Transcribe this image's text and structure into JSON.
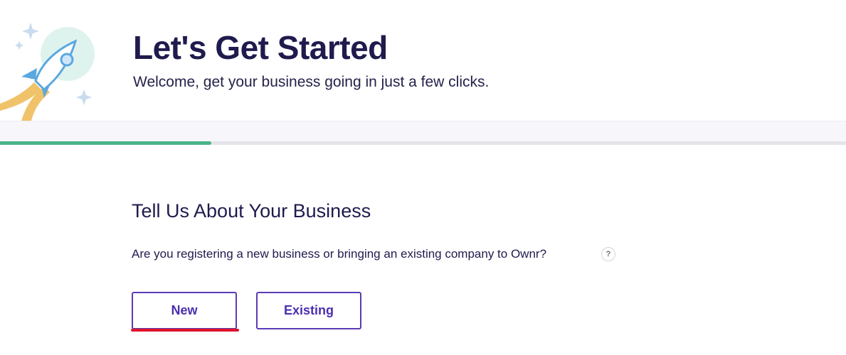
{
  "header": {
    "title": "Let's Get Started",
    "subtitle": "Welcome, get your business going in just a few clicks.",
    "illustration": "rocket-launch-illustration"
  },
  "progress": {
    "fraction": 0.25,
    "color": "#4bb38a"
  },
  "main": {
    "section_title": "Tell Us About Your Business",
    "question": "Are you registering a new business or bringing an existing company to Ownr?",
    "help_icon": {
      "name": "help-icon",
      "glyph": "?"
    },
    "options": [
      {
        "label": "New",
        "selected": true
      },
      {
        "label": "Existing",
        "selected": false
      }
    ]
  },
  "colors": {
    "primary_text": "#1f1b4d",
    "accent": "#5b3bb5",
    "progress": "#4bb38a",
    "selection_underline": "#e0142b"
  }
}
